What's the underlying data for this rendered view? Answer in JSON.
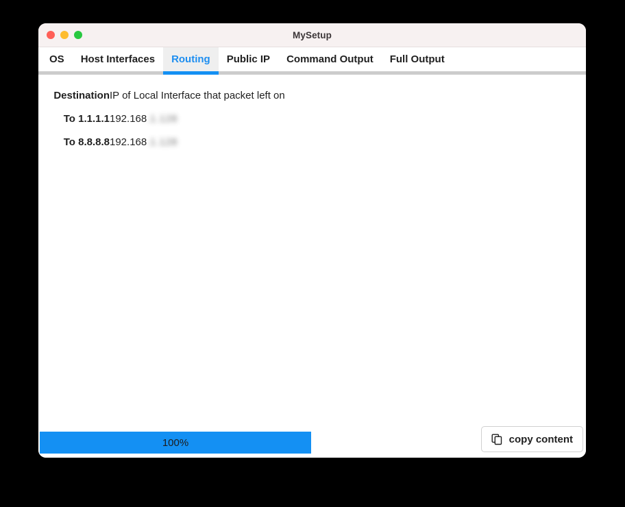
{
  "window": {
    "title": "MySetup",
    "traffic_lights": [
      {
        "name": "close",
        "color": "#ff5f57"
      },
      {
        "name": "minimize",
        "color": "#febc2e"
      },
      {
        "name": "maximize",
        "color": "#28c840"
      }
    ]
  },
  "tabs": [
    {
      "label": "OS",
      "active": false
    },
    {
      "label": "Host Interfaces",
      "active": false
    },
    {
      "label": "Routing",
      "active": true
    },
    {
      "label": "Public IP",
      "active": false
    },
    {
      "label": "Command Output",
      "active": false
    },
    {
      "label": "Full Output",
      "active": false
    }
  ],
  "routing": {
    "header": {
      "destination_label": "Destination",
      "interface_label": "IP of Local Interface that packet left on"
    },
    "rows": [
      {
        "destination": "To 1.1.1.1",
        "ip_prefix": "192.168",
        "ip_redacted": ".1.128"
      },
      {
        "destination": "To 8.8.8.8",
        "ip_prefix": "192.168",
        "ip_redacted": ".1.128"
      }
    ]
  },
  "footer": {
    "progress_value": "100%",
    "progress_percent": 100,
    "copy_button_label": "copy content",
    "copy_icon": "copy-icon"
  },
  "colors": {
    "accent": "#1490f3",
    "titlebar": "#f7f1f1",
    "strip": "#cccccc",
    "active_tab_bg": "#efefef"
  }
}
